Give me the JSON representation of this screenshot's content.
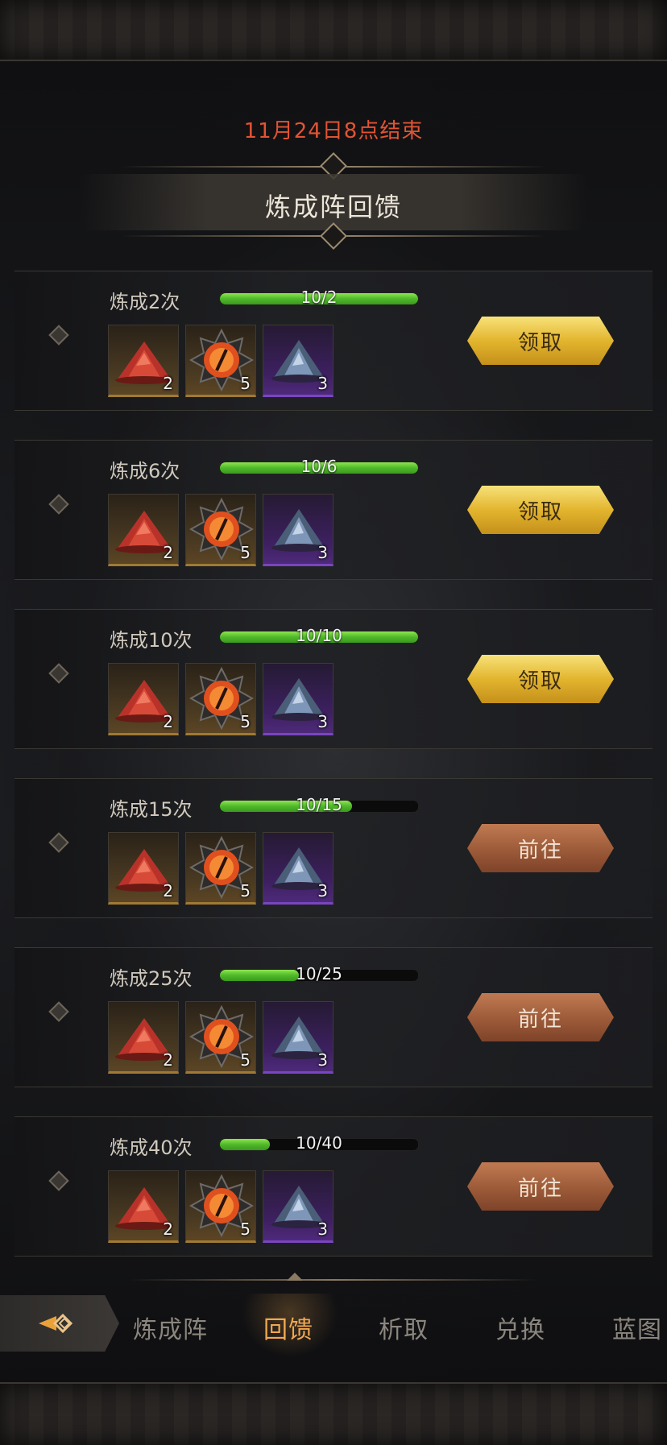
{
  "deadline_text": "11月24日8点结束",
  "title": "炼成阵回馈",
  "colors": {
    "accent_red": "#e05433",
    "progress_green": "#5fc832",
    "claim_gold": "#e3b52e",
    "goto_copper": "#9c5a38",
    "tab_active": "#f0a850"
  },
  "rows": [
    {
      "label": "炼成2次",
      "progress_text": "10/2",
      "progress": 1.0,
      "button": "领取",
      "button_type": "claim",
      "items": [
        {
          "icon": "red-powder-icon",
          "count": "2"
        },
        {
          "icon": "fire-eye-icon",
          "count": "5"
        },
        {
          "icon": "blue-crystal-icon",
          "count": "3"
        }
      ]
    },
    {
      "label": "炼成6次",
      "progress_text": "10/6",
      "progress": 1.0,
      "button": "领取",
      "button_type": "claim",
      "items": [
        {
          "icon": "red-powder-icon",
          "count": "2"
        },
        {
          "icon": "fire-eye-icon",
          "count": "5"
        },
        {
          "icon": "blue-crystal-icon",
          "count": "3"
        }
      ]
    },
    {
      "label": "炼成10次",
      "progress_text": "10/10",
      "progress": 1.0,
      "button": "领取",
      "button_type": "claim",
      "items": [
        {
          "icon": "red-powder-icon",
          "count": "2"
        },
        {
          "icon": "fire-eye-icon",
          "count": "5"
        },
        {
          "icon": "blue-crystal-icon",
          "count": "3"
        }
      ]
    },
    {
      "label": "炼成15次",
      "progress_text": "10/15",
      "progress": 0.667,
      "button": "前往",
      "button_type": "goto",
      "items": [
        {
          "icon": "red-powder-icon",
          "count": "2"
        },
        {
          "icon": "fire-eye-icon",
          "count": "5"
        },
        {
          "icon": "blue-crystal-icon",
          "count": "3"
        }
      ]
    },
    {
      "label": "炼成25次",
      "progress_text": "10/25",
      "progress": 0.4,
      "button": "前往",
      "button_type": "goto",
      "items": [
        {
          "icon": "red-powder-icon",
          "count": "2"
        },
        {
          "icon": "fire-eye-icon",
          "count": "5"
        },
        {
          "icon": "blue-crystal-icon",
          "count": "3"
        }
      ]
    },
    {
      "label": "炼成40次",
      "progress_text": "10/40",
      "progress": 0.25,
      "button": "前往",
      "button_type": "goto",
      "items": [
        {
          "icon": "red-powder-icon",
          "count": "2"
        },
        {
          "icon": "fire-eye-icon",
          "count": "5"
        },
        {
          "icon": "blue-crystal-icon",
          "count": "3"
        }
      ]
    }
  ],
  "tabs": [
    {
      "label": "炼成阵",
      "active": false
    },
    {
      "label": "回馈",
      "active": true
    },
    {
      "label": "析取",
      "active": false
    },
    {
      "label": "兑换",
      "active": false
    },
    {
      "label": "蓝图",
      "active": false
    }
  ],
  "home_icon": "home-diamond-icon"
}
